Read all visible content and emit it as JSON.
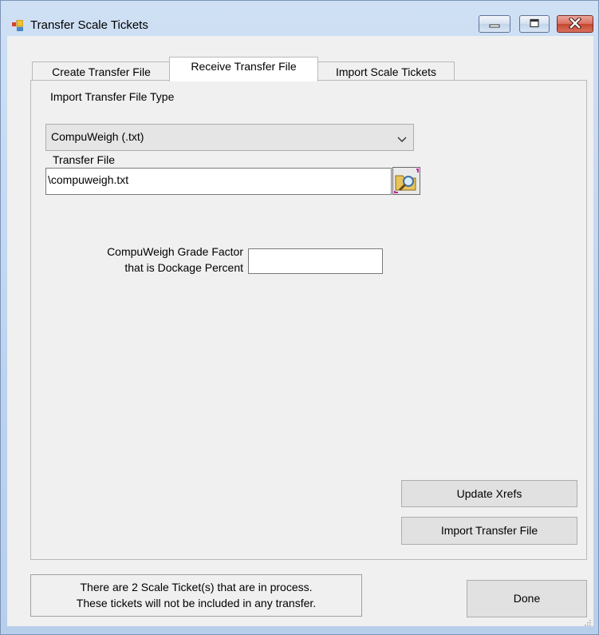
{
  "window": {
    "title": "Transfer Scale Tickets",
    "icon": "app-window-icon",
    "controls": {
      "minimize": "minimize-icon",
      "maximize": "maximize-icon",
      "close": "close-icon"
    }
  },
  "tabs": [
    {
      "label": "Create Transfer File",
      "active": false
    },
    {
      "label": "Receive Transfer File",
      "active": true
    },
    {
      "label": "Import Scale Tickets",
      "active": false
    }
  ],
  "receive_tab": {
    "file_type_label": "Import Transfer File Type",
    "file_type_value": "CompuWeigh (.txt)",
    "transfer_file_label": "Transfer File",
    "transfer_file_value": "\\compuweigh.txt",
    "grade_factor_label_line1": "CompuWeigh Grade Factor",
    "grade_factor_label_line2": "that is Dockage Percent",
    "grade_factor_value": "",
    "update_xrefs_label": "Update Xrefs",
    "import_button_label": "Import Transfer File"
  },
  "status": {
    "line1": "There are 2 Scale Ticket(s) that are in process.",
    "line2": "These tickets will not be included in any transfer."
  },
  "done_label": "Done",
  "colors": {
    "title_bar": "#bcd3ef",
    "client_background": "#f0f0f0",
    "close_button": "#c7472f"
  }
}
